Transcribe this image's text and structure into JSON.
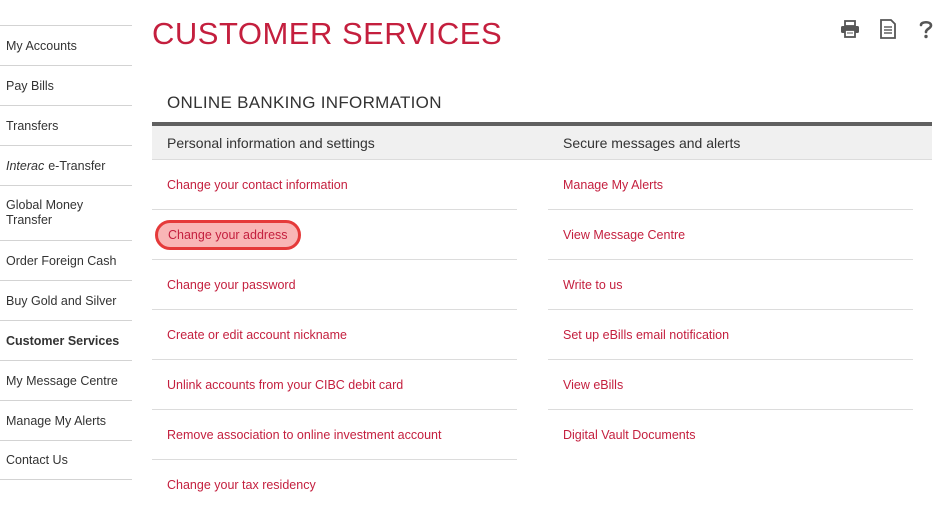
{
  "sidebar": {
    "items": [
      {
        "label": "My Accounts"
      },
      {
        "label": "Pay Bills"
      },
      {
        "label": "Transfers"
      },
      {
        "prefix": "Interac",
        "label": "e-Transfer"
      },
      {
        "label": "Global Money Transfer"
      },
      {
        "label": "Order Foreign Cash"
      },
      {
        "label": "Buy Gold and Silver"
      },
      {
        "label": "Customer Services",
        "active": true
      },
      {
        "label": "My Message Centre"
      },
      {
        "label": "Manage My Alerts"
      },
      {
        "label": "Contact Us"
      }
    ]
  },
  "header": {
    "title": "CUSTOMER SERVICES",
    "tools": [
      "print-icon",
      "document-icon",
      "help-icon"
    ]
  },
  "section": {
    "title": "ONLINE BANKING INFORMATION",
    "left": {
      "heading": "Personal information and settings",
      "links": [
        "Change your contact information",
        "Change your address",
        "Change your password",
        "Create or edit account nickname",
        "Unlink accounts from your CIBC debit card",
        "Remove association to online investment account",
        "Change your tax residency"
      ],
      "highlighted_index": 1
    },
    "right": {
      "heading": "Secure messages and alerts",
      "links": [
        "Manage My Alerts",
        "View Message Centre",
        "Write to us",
        "Set up eBills email notification",
        "View eBills",
        "Digital Vault Documents"
      ]
    }
  },
  "colors": {
    "brand_red": "#c41f3e",
    "highlight_fill": "#f9b6b6",
    "highlight_border": "#e53a3a",
    "section_bar": "#606060"
  }
}
